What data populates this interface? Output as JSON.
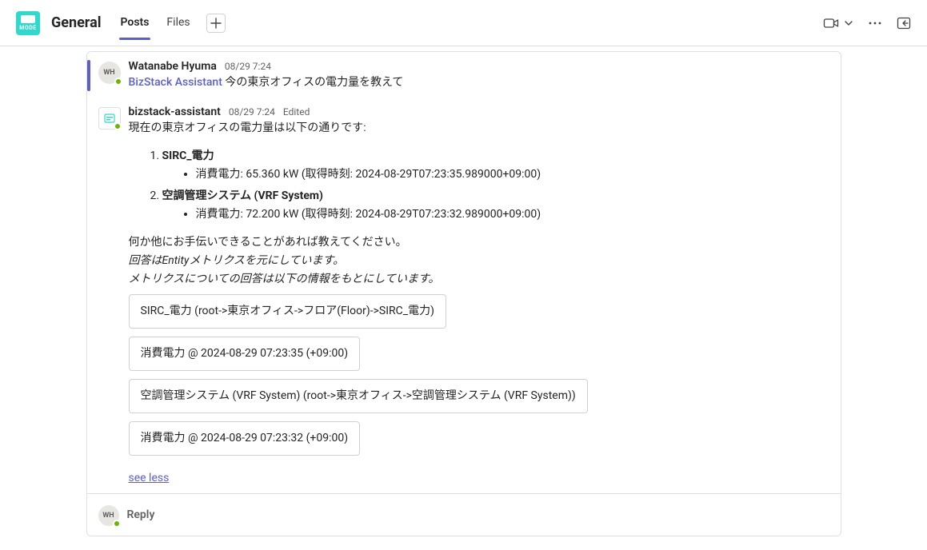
{
  "header": {
    "channel_name": "General",
    "tabs": [
      "Posts",
      "Files"
    ],
    "active_tab_index": 0
  },
  "thread": {
    "root": {
      "author": "Watanabe Hyuma",
      "avatar_initials": "WH",
      "timestamp": "08/29 7:24",
      "mention": "BizStack Assistant",
      "text": "今の東京オフィスの電力量を教えて"
    },
    "reply": {
      "author": "bizstack-assistant",
      "timestamp": "08/29 7:24",
      "edited_label": "Edited",
      "intro": "現在の東京オフィスの電力量は以下の通りです:",
      "items": [
        {
          "title": "SIRC_電力",
          "detail": "消費電力: 65.360 kW (取得時刻: 2024-08-29T07:23:35.989000+09:00)"
        },
        {
          "title": "空調管理システム (VRF System)",
          "detail": "消費電力: 72.200 kW (取得時刻: 2024-08-29T07:23:32.989000+09:00)"
        }
      ],
      "footer1": "何か他にお手伝いできることがあれば教えてください。",
      "footer2": "回答はEntityメトリクスを元にしています。",
      "footer3": "メトリクスについての回答は以下の情報をもとにしています。",
      "chips": [
        "SIRC_電力 (root->東京オフィス->フロア(Floor)->SIRC_電力)",
        "消費電力 @ 2024-08-29 07:23:35 (+09:00)",
        "空調管理システム (VRF System) (root->東京オフィス->空調管理システム (VRF System))",
        "消費電力 @ 2024-08-29 07:23:32 (+09:00)"
      ],
      "see_less": "see less"
    }
  },
  "reply_box": {
    "avatar_initials": "WH",
    "placeholder": "Reply"
  }
}
